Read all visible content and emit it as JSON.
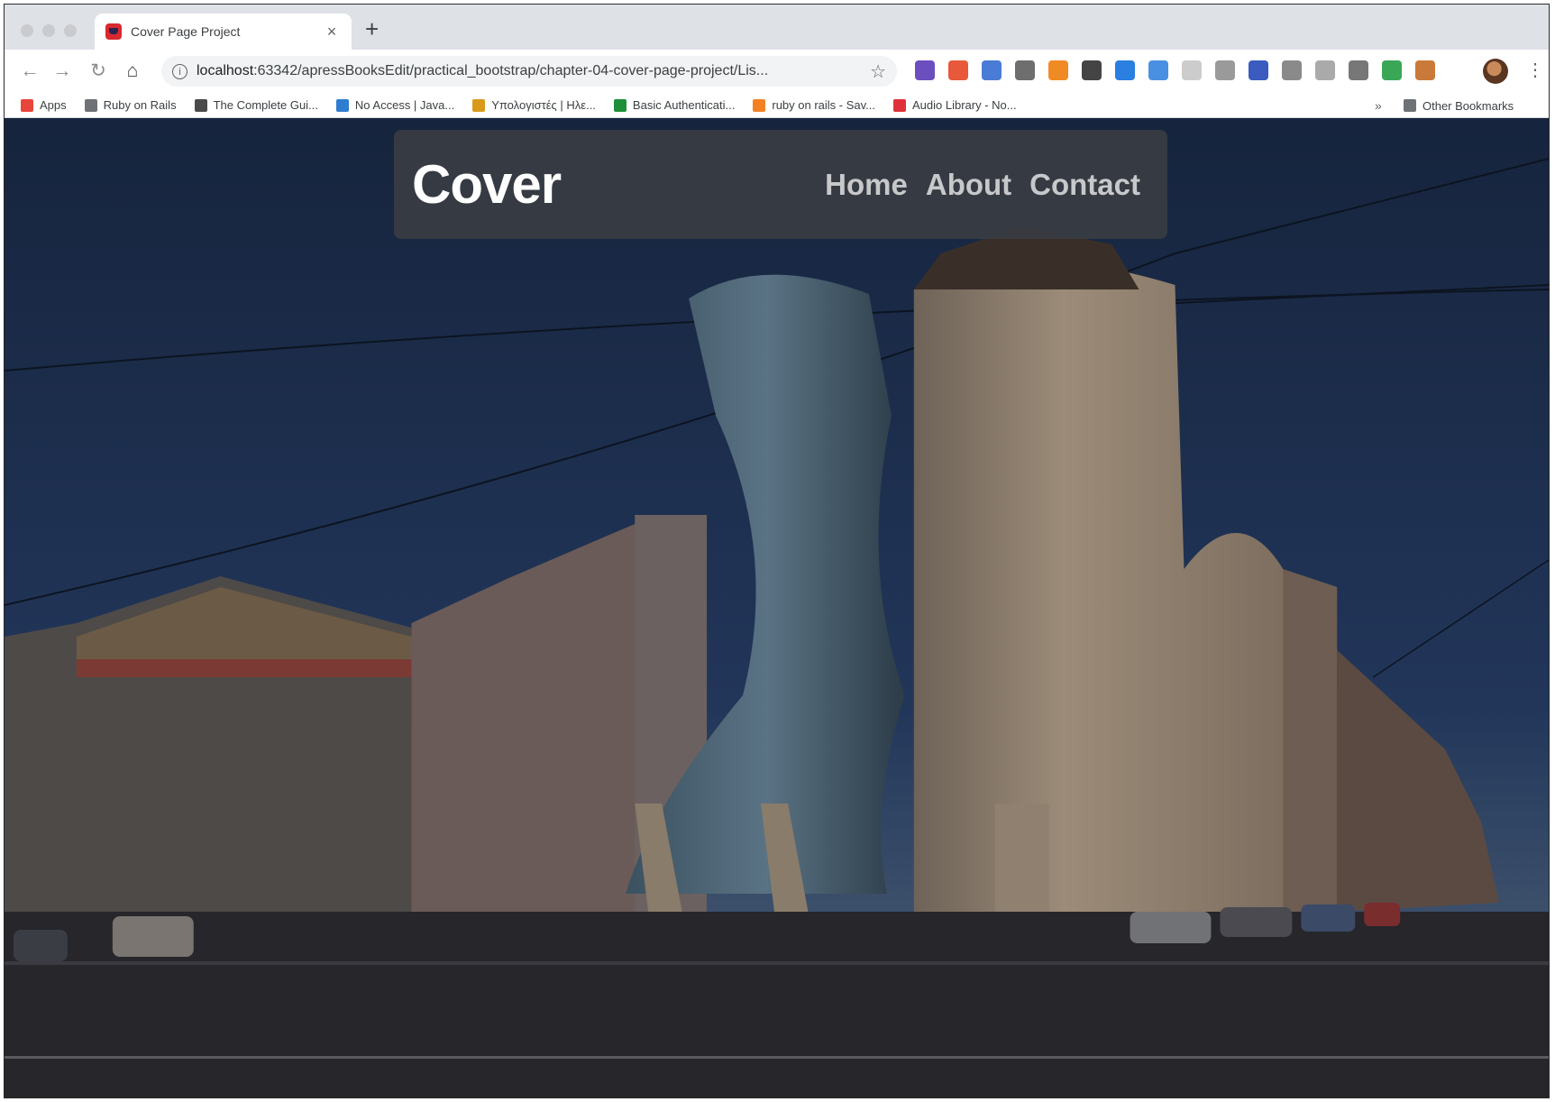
{
  "browser": {
    "tab": {
      "title": "Cover Page Project"
    },
    "address_bar": {
      "host": "localhost",
      "rest": ":63342/apressBooksEdit/practical_bootstrap/chapter-04-cover-page-project/Lis..."
    },
    "extension_colors": [
      "#6b4fbf",
      "#e8583b",
      "#4a7bd6",
      "#6e6e6e",
      "#f08a24",
      "#444444",
      "#2a7fe0",
      "#4a90e2",
      "#cccccc",
      "#9a9a9a",
      "#3b5bbf",
      "#8a8a8a",
      "#aaaaaa",
      "#777777",
      "#3aa757",
      "#c97a3a"
    ]
  },
  "bookmarks": [
    {
      "label": "Apps",
      "icon": "apps-grid-icon",
      "color": "#e8453c"
    },
    {
      "label": "Ruby on Rails",
      "icon": "folder-icon",
      "color": "#6e7175"
    },
    {
      "label": "The Complete Gui...",
      "icon": "bookmark-icon",
      "color": "#4a4a4a"
    },
    {
      "label": "No Access | Java...",
      "icon": "bookmark-icon",
      "color": "#2f7dd1"
    },
    {
      "label": "Υπολογιστές | Ηλε...",
      "icon": "bookmark-icon",
      "color": "#d99a1a"
    },
    {
      "label": "Basic Authenticati...",
      "icon": "bookmark-icon",
      "color": "#1e8f3a"
    },
    {
      "label": "ruby on rails - Sav...",
      "icon": "bookmark-icon",
      "color": "#f48024"
    },
    {
      "label": "Audio Library - No...",
      "icon": "bookmark-icon",
      "color": "#e0313b"
    }
  ],
  "bookmarks_more": "»",
  "other_bookmarks": "Other Bookmarks",
  "page": {
    "brand": "Cover",
    "nav": [
      {
        "label": "Home"
      },
      {
        "label": "About"
      },
      {
        "label": "Contact"
      }
    ]
  }
}
